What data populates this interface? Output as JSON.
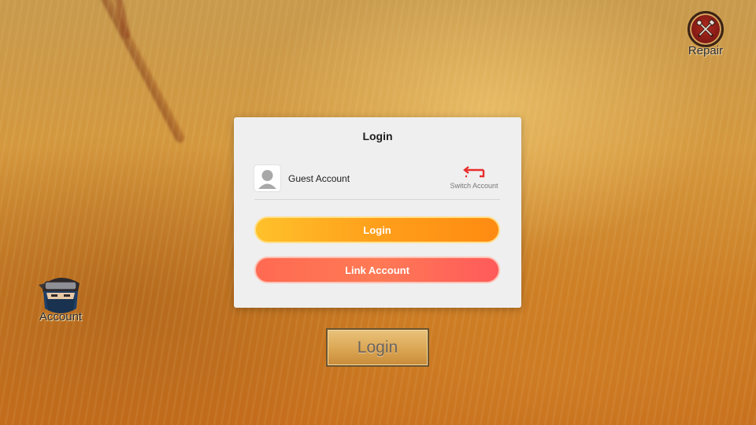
{
  "repair": {
    "label": "Repair",
    "icon": "repair-tools-icon"
  },
  "account": {
    "label": "Account",
    "icon": "ninja-avatar-icon"
  },
  "dialog": {
    "title": "Login",
    "account_row": {
      "name": "Guest Account",
      "avatar_icon": "person-icon",
      "switch_label": "Switch Account",
      "switch_icon": "swap-arrows-icon"
    },
    "login_button": "Login",
    "link_button": "Link Account"
  },
  "game_login_button": "Login",
  "colors": {
    "login_gradient": [
      "#ffc12b",
      "#ff8b12"
    ],
    "link_gradient": [
      "#ff6a52",
      "#ff5a5a"
    ],
    "switch_icon": "#e82d2d",
    "dialog_bg": "#efefef"
  }
}
